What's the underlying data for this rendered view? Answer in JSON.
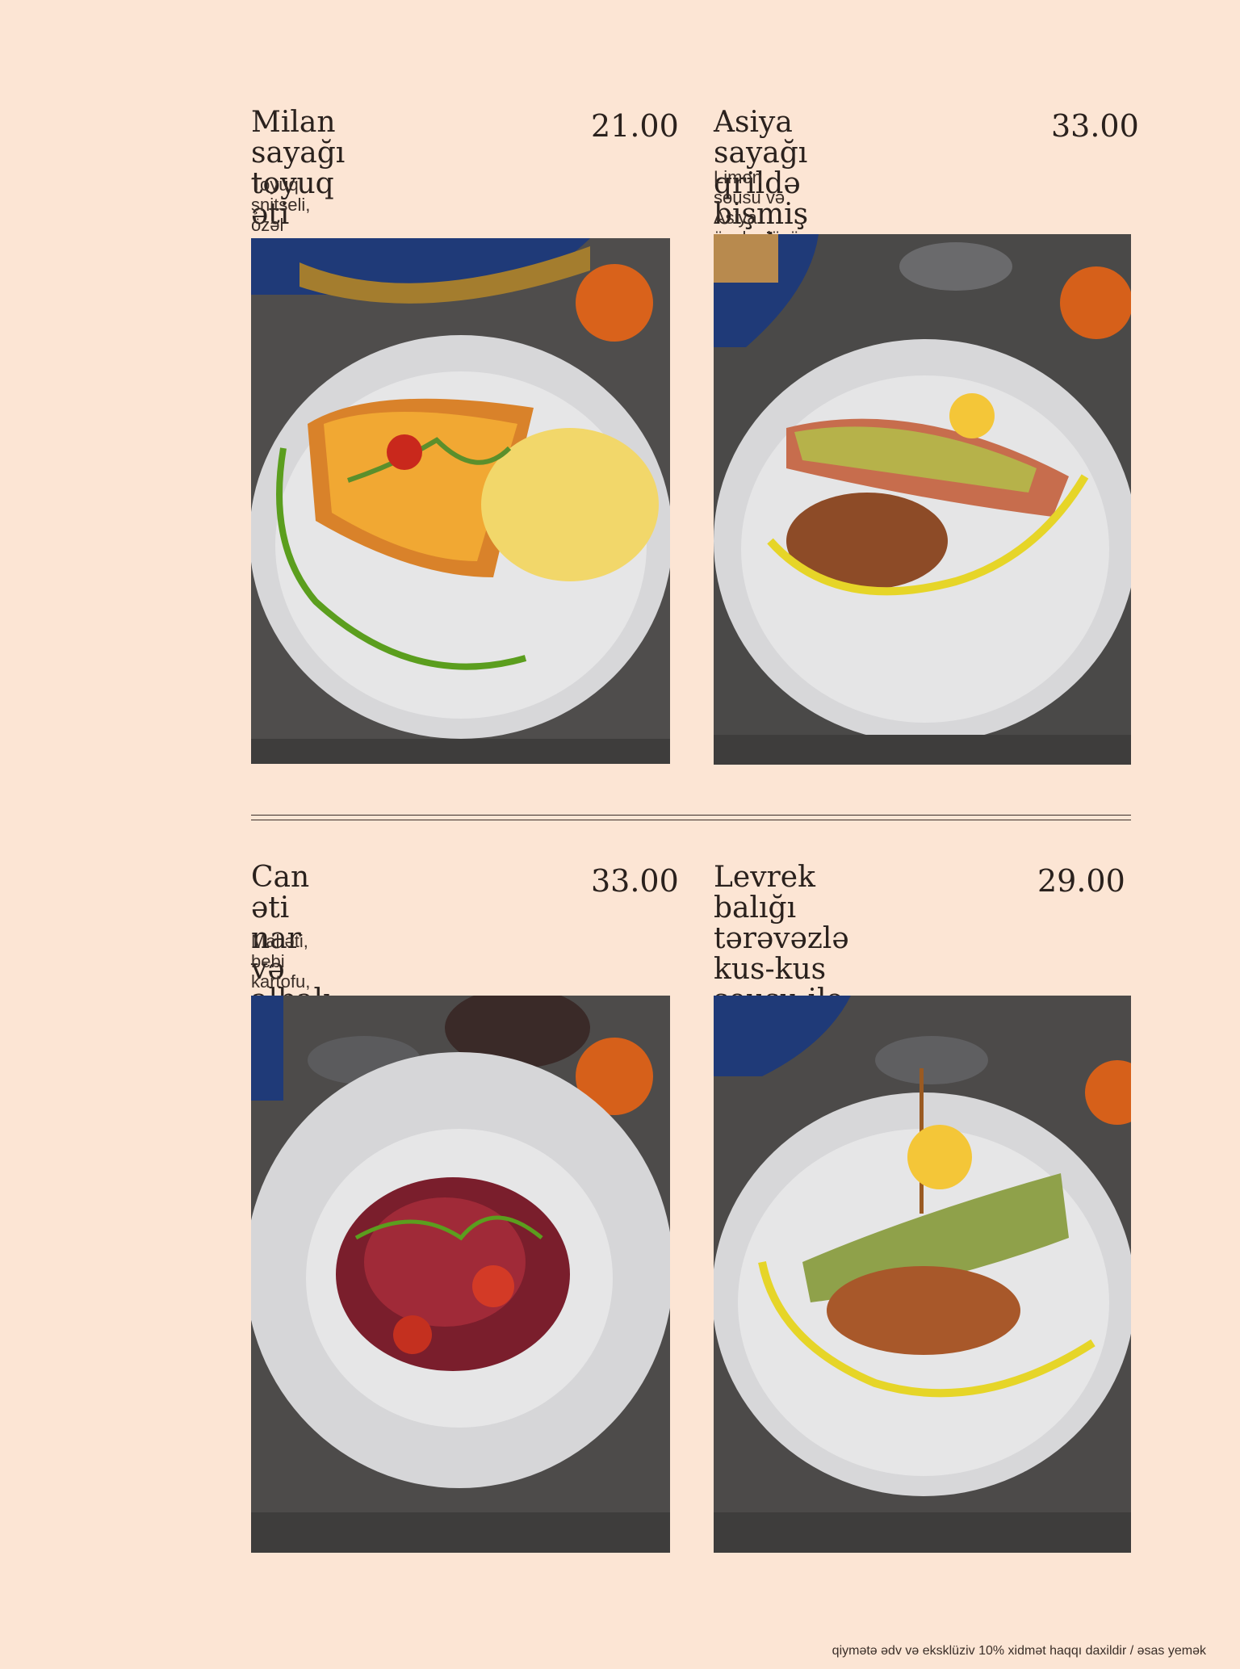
{
  "menu": {
    "items": [
      {
        "title": "Milan sayağı\ntoyuq əti",
        "price": "21.00",
        "description": "Toyuq şnitseli, özəl pomidor sousu, çedar\npendiri. Pendirli fettuçini ilə servis edilir",
        "photo_icon": "plated-chicken-schnitzel-photo"
      },
      {
        "title": "Asiya sayağı qrildə\nbişmiş qızıl balıq düyü ilə",
        "price": "33.00",
        "description": "Limon sousu və Asiya üsulu düyü ilə\nqrildə qızardılmış qızılbalıq",
        "photo_icon": "plated-grilled-salmon-photo"
      },
      {
        "title": "Can əti nar və\nalbalı-zogal sousu ilə",
        "price": "33.00",
        "description": "Mal əti, bebi kartofu, qırmızı bibər\nalbalı-zoğal sousu ilə",
        "photo_icon": "plated-beef-photo"
      },
      {
        "title": "Levrek balığı\ntərəvəzlə kus-kus\nsousu ilə",
        "price": "29.00",
        "description": "",
        "photo_icon": "plated-sea-bass-photo"
      }
    ]
  },
  "footer": {
    "note": "qiymətə ədv və eksklüziv 10% xidmət haqqı daxildir / əsas yemək"
  }
}
